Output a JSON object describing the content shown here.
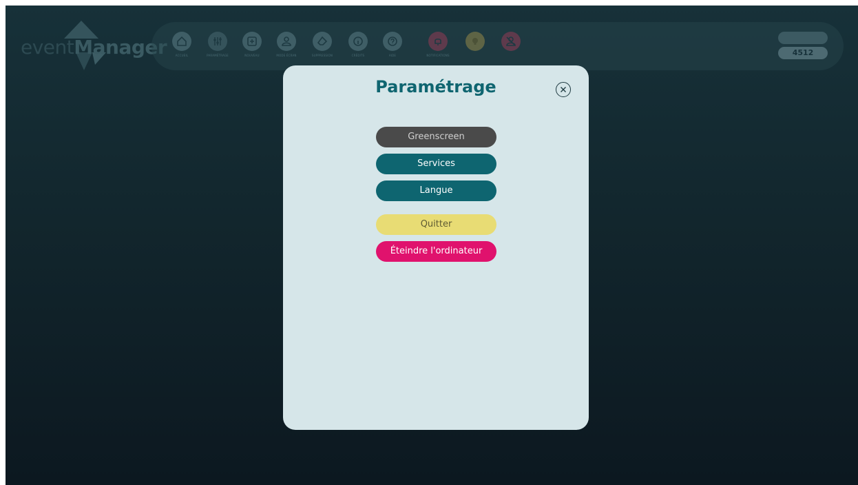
{
  "app": {
    "logo_part1": "event",
    "logo_part2": "Manager"
  },
  "toolbar": {
    "items": [
      {
        "label": "ACCUEIL",
        "icon": "home-icon"
      },
      {
        "label": "PARAMÉTRAGE",
        "icon": "sliders-icon"
      },
      {
        "label": "NOUVEAU",
        "icon": "plus-square-icon"
      },
      {
        "label": "MODE ÉCRAN",
        "icon": "user-icon"
      },
      {
        "label": "SUPPRESSION",
        "icon": "eraser-icon"
      },
      {
        "label": "CRÉDITS",
        "icon": "info-icon"
      },
      {
        "label": "AIDE",
        "icon": "help-icon"
      },
      {
        "label": "NOTIFICATIONS",
        "icon": "bell-icon"
      },
      {
        "label": "",
        "icon": "bulb-icon"
      },
      {
        "label": "",
        "icon": "user-off-icon"
      }
    ],
    "counter_value": "4512"
  },
  "modal": {
    "title": "Paramétrage",
    "buttons": {
      "greenscreen": "Greenscreen",
      "services": "Services",
      "langue": "Langue",
      "quitter": "Quitter",
      "eteindre": "Éteindre l'ordinateur"
    }
  },
  "colors": {
    "teal_accent": "#0e6570",
    "modal_bg": "#d6e6e9",
    "greenscreen_btn": "#4a4a4a",
    "quit_btn": "#e8dc74",
    "shutdown_btn": "#e0126d"
  }
}
